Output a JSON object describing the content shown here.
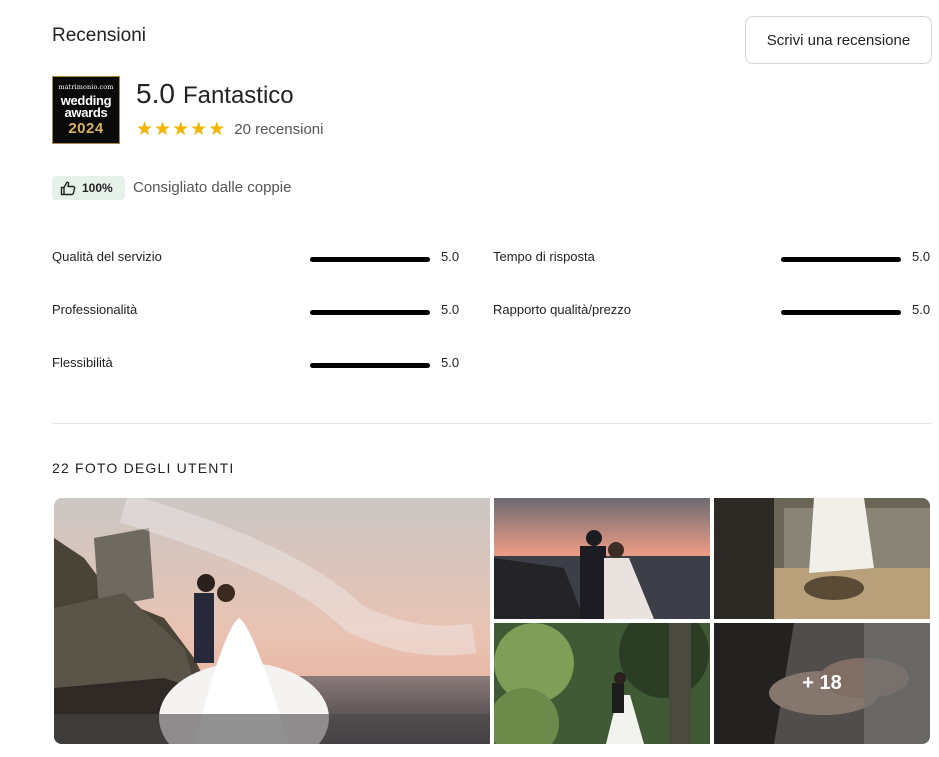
{
  "header": {
    "title": "Recensioni",
    "write_review_label": "Scrivi una recensione"
  },
  "award": {
    "brand": "matrimonio.com",
    "line1": "wedding",
    "line2": "awards",
    "year": "2024"
  },
  "summary": {
    "score": "5.0",
    "score_word": "Fantastico",
    "stars": 5,
    "review_count_text": "20 recensioni"
  },
  "recommend": {
    "icon": "thumbs-up-icon",
    "percent": "100%",
    "text": "Consigliato dalle coppie"
  },
  "ratings": [
    {
      "label": "Qualità del servizio",
      "value": "5.0",
      "fraction": 1.0
    },
    {
      "label": "Tempo di risposta",
      "value": "5.0",
      "fraction": 1.0
    },
    {
      "label": "Professionalità",
      "value": "5.0",
      "fraction": 1.0
    },
    {
      "label": "Rapporto qualità/prezzo",
      "value": "5.0",
      "fraction": 1.0
    },
    {
      "label": "Flessibilità",
      "value": "5.0",
      "fraction": 1.0
    }
  ],
  "photos": {
    "title": "22 FOTO DEGLI UTENTI",
    "more_label": "+ 18"
  },
  "colors": {
    "star": "#f4b400",
    "badge_bg": "#e6f1ea",
    "award_gold": "#d9b25e"
  }
}
